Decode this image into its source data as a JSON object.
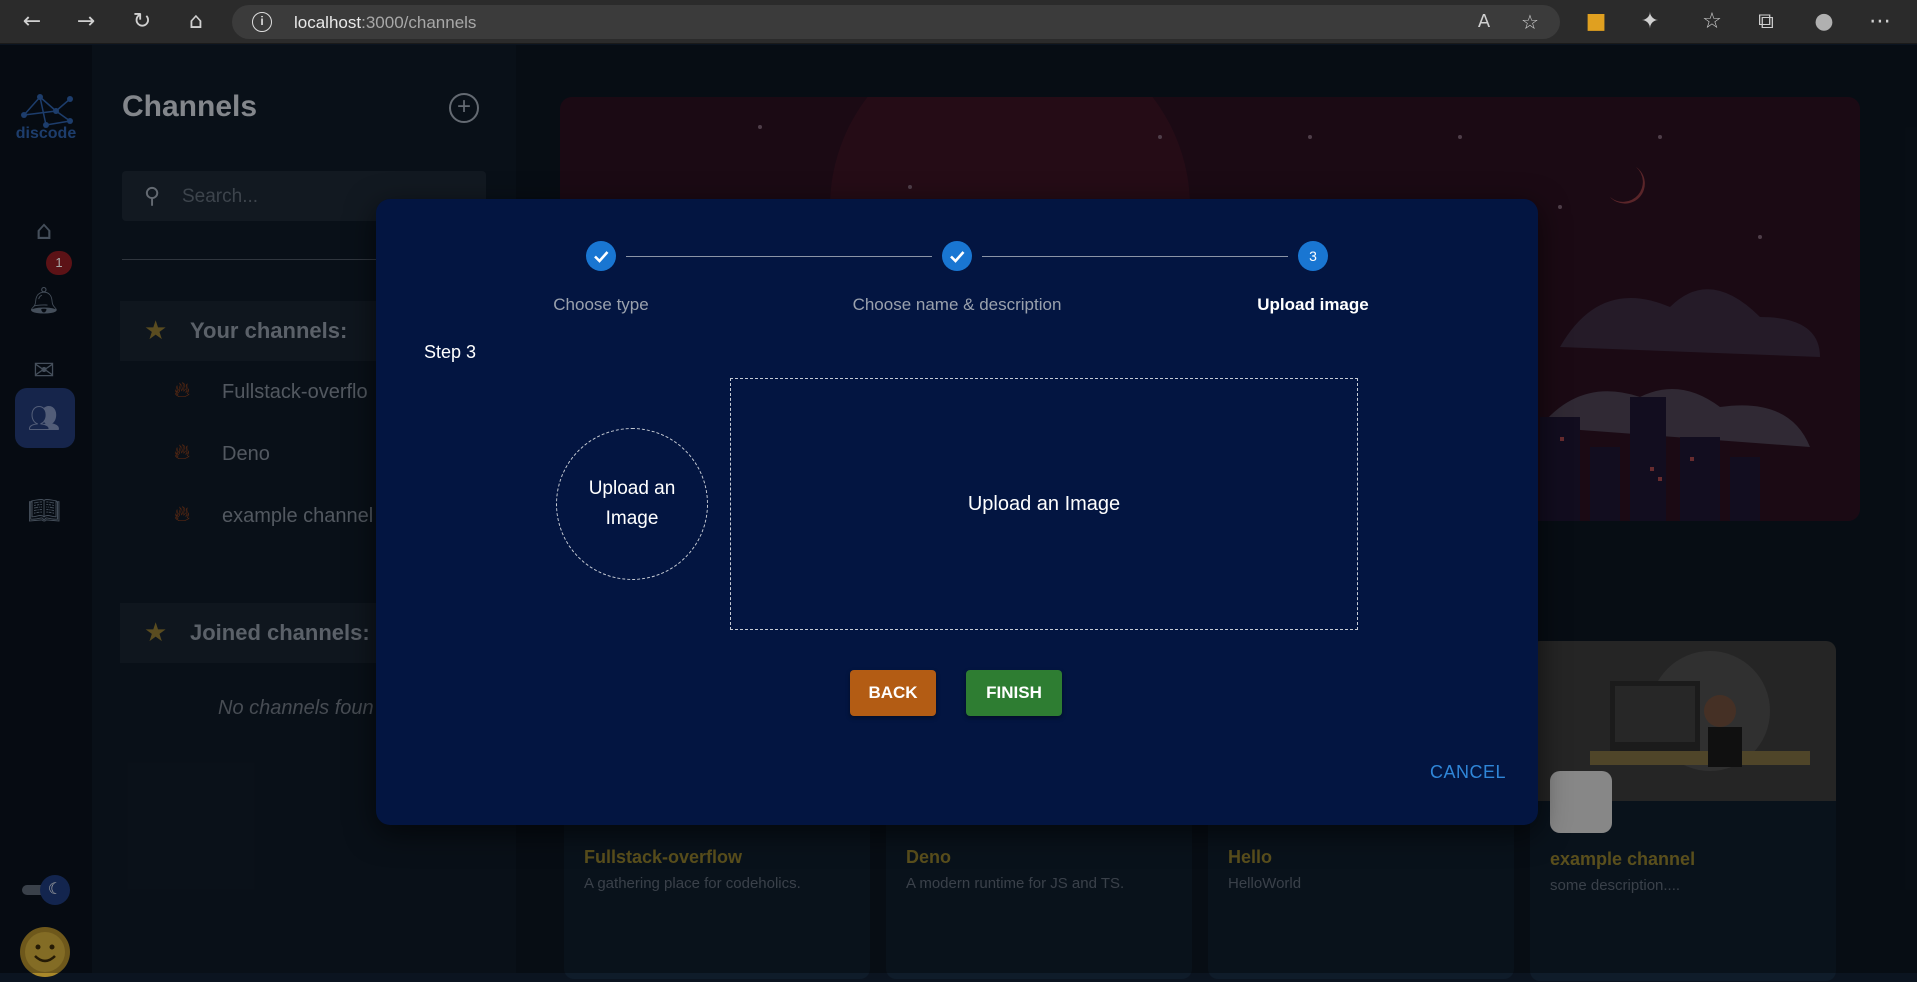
{
  "browser": {
    "url_host": "localhost",
    "url_path": ":3000/channels"
  },
  "rail": {
    "logo_text": "discode",
    "notification_count": "1"
  },
  "panel": {
    "title": "Channels",
    "search_placeholder": "Search...",
    "your_channels_label": "Your channels:",
    "your_channels": [
      "Fullstack-overflo",
      "Deno",
      "example channel"
    ],
    "joined_channels_label": "Joined channels:",
    "no_channels_text": "No channels foun"
  },
  "cards": [
    {
      "title": "Fullstack-overflow",
      "description": "A gathering place for codeholics."
    },
    {
      "title": "Deno",
      "description": "A modern runtime for JS and TS."
    },
    {
      "title": "Hello",
      "description": "HelloWorld"
    },
    {
      "title": "example channel",
      "description": "some description...."
    }
  ],
  "modal": {
    "steps": [
      {
        "label": "Choose type",
        "state": "done"
      },
      {
        "label": "Choose name & description",
        "state": "done"
      },
      {
        "label": "Upload image",
        "state": "active",
        "number": "3"
      }
    ],
    "step_heading": "Step 3",
    "avatar_upload_text": "Upload an Image",
    "banner_upload_text": "Upload an Image",
    "back_label": "BACK",
    "finish_label": "FINISH",
    "cancel_label": "CANCEL"
  },
  "colors": {
    "modal_bg": "#031541",
    "step_blue": "#1976d2",
    "back_button": "#b35c14",
    "finish_button": "#2e7d32",
    "cancel_text": "#2f86d8"
  }
}
